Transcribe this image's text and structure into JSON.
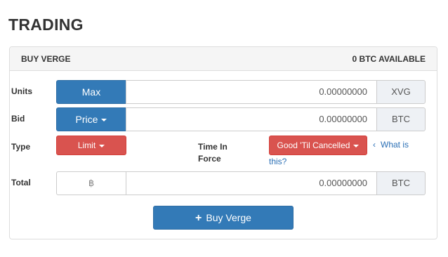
{
  "page": {
    "title": "TRADING"
  },
  "panel": {
    "heading": "BUY VERGE",
    "available": "0 BTC AVAILABLE"
  },
  "units": {
    "label": "Units",
    "button": "Max",
    "value": "0.00000000",
    "unit": "XVG"
  },
  "bid": {
    "label": "Bid",
    "button": "Price",
    "value": "0.00000000",
    "unit": "BTC"
  },
  "type": {
    "label": "Type",
    "button": "Limit"
  },
  "time_in_force": {
    "label_line1": "Time In",
    "label_line2": "Force",
    "button": "Good 'Til Cancelled",
    "help_line1": "What is",
    "help_line2": "this?"
  },
  "total": {
    "label": "Total",
    "currency_symbol": "฿",
    "value": "0.00000000",
    "unit": "BTC"
  },
  "submit": {
    "label": "Buy Verge"
  },
  "colors": {
    "primary": "#337ab7",
    "danger": "#d9534f",
    "addon_bg": "#eef1f5"
  }
}
